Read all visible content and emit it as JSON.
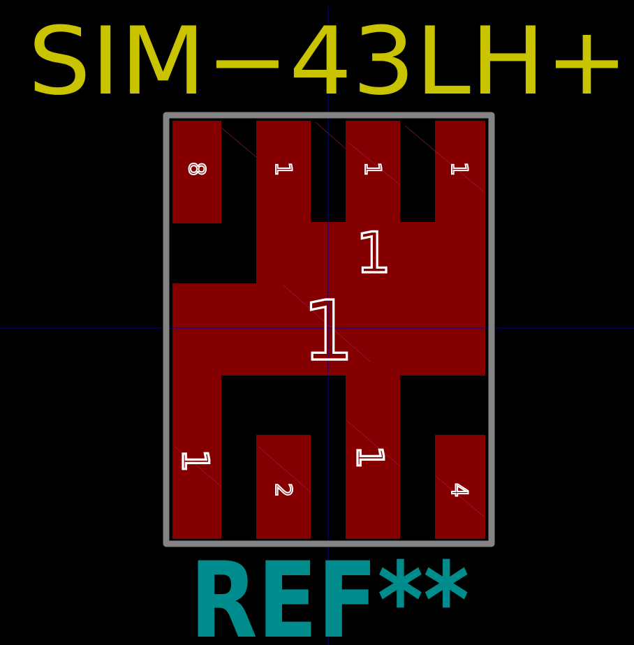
{
  "footprint": {
    "value_label": "SIM−43LH+",
    "reference_label": "REF**",
    "center_pad_label": "1",
    "upper_pad_label": "1",
    "pins_top": [
      "8",
      "1",
      "1",
      "1"
    ],
    "pins_bottom": [
      "1",
      "2",
      "1",
      "4"
    ]
  },
  "colors": {
    "background": "#000000",
    "pad": "#840000",
    "courtyard": "#848484",
    "value_text": "#c9c300",
    "reference_text": "#008c8c",
    "pin_label": "#ffffff",
    "crosshair": "#0000a0"
  }
}
